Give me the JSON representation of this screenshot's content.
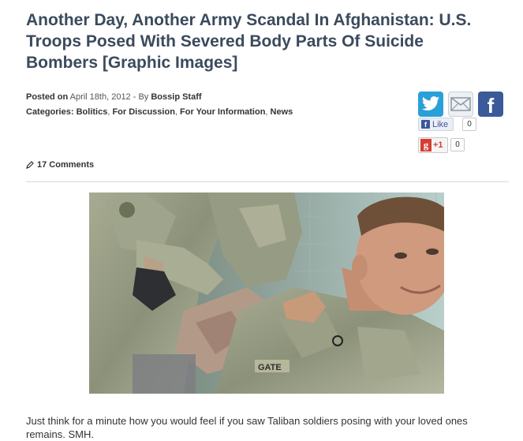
{
  "article": {
    "title": "Another Day, Another Army Scandal In Afghanistan: U.S. Troops Posed With Severed Body Parts Of Suicide Bombers [Graphic Images]",
    "posted_label": "Posted on",
    "posted_date": "April 18th, 2012",
    "by_label": " - By ",
    "author": "Bossip Staff",
    "categories_label": "Categories:",
    "categories": [
      "Bolitics",
      "For Discussion",
      "For Your Information",
      "News"
    ],
    "comments": "17 Comments",
    "caption": "Just think for a minute how you would feel if you saw Taliban soldiers posing with your loved ones remains. SMH."
  },
  "share": {
    "icons": [
      "twitter-icon",
      "email-icon",
      "facebook-icon"
    ],
    "like_label": "Like",
    "like_count": "0",
    "gplus_label": "+1",
    "gplus_count": "0"
  },
  "photo": {
    "name_tape": "GATE"
  },
  "colors": {
    "title": "#3b4a5c",
    "twitter": "#2aa0d8",
    "facebook": "#3b5a99",
    "gplus": "#d73d32"
  }
}
